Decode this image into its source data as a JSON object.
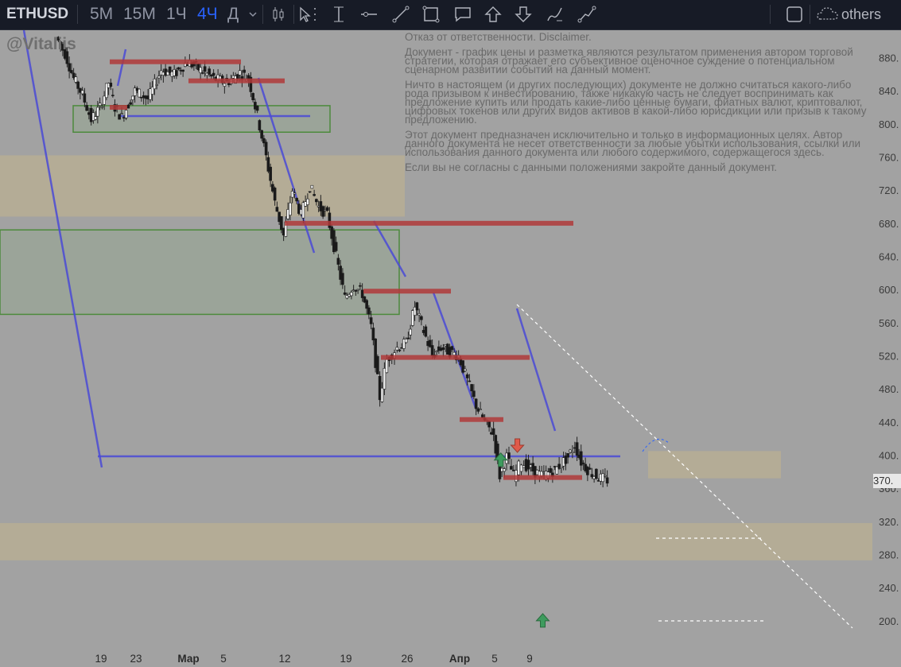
{
  "toolbar": {
    "symbol": "ETHUSD",
    "timeframes": [
      {
        "label": "5M",
        "active": false
      },
      {
        "label": "15M",
        "active": false
      },
      {
        "label": "1Ч",
        "active": false
      },
      {
        "label": "4Ч",
        "active": true
      },
      {
        "label": "Д",
        "active": false
      }
    ],
    "tools": [
      "candle-type-icon",
      "cursor-icon",
      "vertical-line-icon",
      "horizontal-line-icon",
      "trend-line-icon",
      "rectangle-icon",
      "comment-icon",
      "arrow-up-icon",
      "arrow-down-icon",
      "brush-icon",
      "path-icon"
    ],
    "others_label": "others"
  },
  "watermark": "@Vitaliis",
  "disclaimer": [
    "Отказ от ответственности. Disclaimer.",
    "Документ - график цены и разметка являются результатом применения автором торговой стратегии, которая отражает его субъективное оценочное суждение о потенциальном сценарном развитии событий на данный момент.",
    "Ничто в настоящем (и других последующих) документе не должно считаться какого-либо рода призывом к инвестированию, также никакую часть не следует воспринимать как предложение купить или продать какие-либо ценные бумаги, фиатных валют, криптовалют, цифровых токенов или других видов активов в какой-либо юрисдикции или призыв к такому предложению.",
    "Этот документ предназначен исключительно и только в информационных целях. Автор данного документа не несет ответственности за любые убытки использования, ссылки или использования данного документа или любого содержимого, содержащегося здесь.",
    "Если вы не согласны с данными положениями закройте данный документ."
  ],
  "price_tag": "370.",
  "colors": {
    "background": "#a2a2a2",
    "toolbar": "#171b26",
    "active_timeframe": "#2962ff",
    "resistance": "#b03a3a",
    "trendline": "#4a4ad6",
    "zone_tan": "#c2b48c",
    "zone_green": "#4c8a3c",
    "arrow_up": "#3e9b5e",
    "arrow_down": "#e05a4a"
  },
  "chart_data": {
    "type": "candlestick",
    "symbol": "ETHUSD",
    "interval": "4Ч",
    "y_ticks": [
      880,
      840,
      800,
      760,
      720,
      680,
      640,
      600,
      560,
      520,
      480,
      440,
      400,
      360,
      320,
      280,
      240,
      200
    ],
    "y_tick_labels": [
      "880.",
      "840.",
      "800.",
      "760.",
      "720.",
      "680.",
      "640.",
      "600.",
      "560.",
      "520.",
      "480.",
      "440.",
      "400.",
      "360.",
      "320.",
      "280.",
      "240.",
      "200."
    ],
    "x_ticks": [
      "19",
      "23",
      "Мар",
      "5",
      "12",
      "19",
      "26",
      "Апр",
      "5",
      "9"
    ],
    "ylim": [
      180,
      915
    ],
    "current_price": 370,
    "price_path": [
      {
        "d": -15,
        "p": 905
      },
      {
        "d": -14,
        "p": 885
      },
      {
        "d": -13,
        "p": 855
      },
      {
        "d": -12,
        "p": 835
      },
      {
        "d": -11,
        "p": 805
      },
      {
        "d": -10,
        "p": 820
      },
      {
        "d": -9,
        "p": 850
      },
      {
        "d": -8.3,
        "p": 820
      },
      {
        "d": -7.5,
        "p": 808
      },
      {
        "d": -6,
        "p": 840
      },
      {
        "d": -4.5,
        "p": 830
      },
      {
        "d": -3,
        "p": 865
      },
      {
        "d": -1.5,
        "p": 860
      },
      {
        "d": 0,
        "p": 875
      },
      {
        "d": 1.5,
        "p": 865
      },
      {
        "d": 3,
        "p": 855
      },
      {
        "d": 4.5,
        "p": 850
      },
      {
        "d": 6,
        "p": 862
      },
      {
        "d": 7,
        "p": 855
      },
      {
        "d": 8,
        "p": 810
      },
      {
        "d": 9,
        "p": 760
      },
      {
        "d": 10,
        "p": 705
      },
      {
        "d": 11,
        "p": 665
      },
      {
        "d": 12,
        "p": 720
      },
      {
        "d": 13,
        "p": 690
      },
      {
        "d": 14,
        "p": 725
      },
      {
        "d": 15,
        "p": 700
      },
      {
        "d": 16,
        "p": 690
      },
      {
        "d": 17,
        "p": 640
      },
      {
        "d": 18,
        "p": 590
      },
      {
        "d": 19,
        "p": 605
      },
      {
        "d": 20,
        "p": 595
      },
      {
        "d": 21,
        "p": 555
      },
      {
        "d": 22,
        "p": 470
      },
      {
        "d": 22.8,
        "p": 515
      },
      {
        "d": 24,
        "p": 530
      },
      {
        "d": 25,
        "p": 535
      },
      {
        "d": 26,
        "p": 580
      },
      {
        "d": 27,
        "p": 550
      },
      {
        "d": 28,
        "p": 520
      },
      {
        "d": 29,
        "p": 530
      },
      {
        "d": 30,
        "p": 525
      },
      {
        "d": 31,
        "p": 520
      },
      {
        "d": 32,
        "p": 490
      },
      {
        "d": 33,
        "p": 460
      },
      {
        "d": 34,
        "p": 440
      },
      {
        "d": 35,
        "p": 425
      },
      {
        "d": 35.7,
        "p": 375
      },
      {
        "d": 36.5,
        "p": 398
      },
      {
        "d": 37.3,
        "p": 375
      },
      {
        "d": 38.2,
        "p": 392
      },
      {
        "d": 39,
        "p": 385
      },
      {
        "d": 40.5,
        "p": 375
      },
      {
        "d": 42,
        "p": 382
      },
      {
        "d": 43.5,
        "p": 398
      },
      {
        "d": 44.3,
        "p": 412
      },
      {
        "d": 45,
        "p": 392
      },
      {
        "d": 46,
        "p": 380
      },
      {
        "d": 47,
        "p": 373
      },
      {
        "d": 48,
        "p": 370
      }
    ],
    "levels": [
      {
        "price": 875,
        "d_start": -9,
        "d_end": 6
      },
      {
        "price": 852,
        "d_start": 0,
        "d_end": 11
      },
      {
        "price": 820,
        "d_start": -9,
        "d_end": -7
      },
      {
        "price": 680,
        "d_start": 11,
        "d_end": 44
      },
      {
        "price": 598,
        "d_start": 20,
        "d_end": 30
      },
      {
        "price": 518,
        "d_start": 22,
        "d_end": 39
      },
      {
        "price": 443,
        "d_start": 31,
        "d_end": 36
      },
      {
        "price": 373,
        "d_start": 36,
        "d_end": 45
      }
    ],
    "zones": [
      {
        "kind": "tan",
        "price_top": 762,
        "price_bottom": 688
      },
      {
        "kind": "green",
        "price_top": 672,
        "price_bottom": 570
      },
      {
        "kind": "green",
        "price_top": 822,
        "price_bottom": 790
      },
      {
        "kind": "tan",
        "price_top": 405,
        "price_bottom": 372
      },
      {
        "kind": "tan",
        "price_top": 318,
        "price_bottom": 273
      }
    ],
    "annotations": [
      {
        "kind": "arrow-up",
        "d": 35.7,
        "price": 394
      },
      {
        "kind": "arrow-down",
        "d": 37.6,
        "price": 412
      },
      {
        "kind": "arrow-up",
        "d": 40.5,
        "price": 200
      }
    ]
  }
}
